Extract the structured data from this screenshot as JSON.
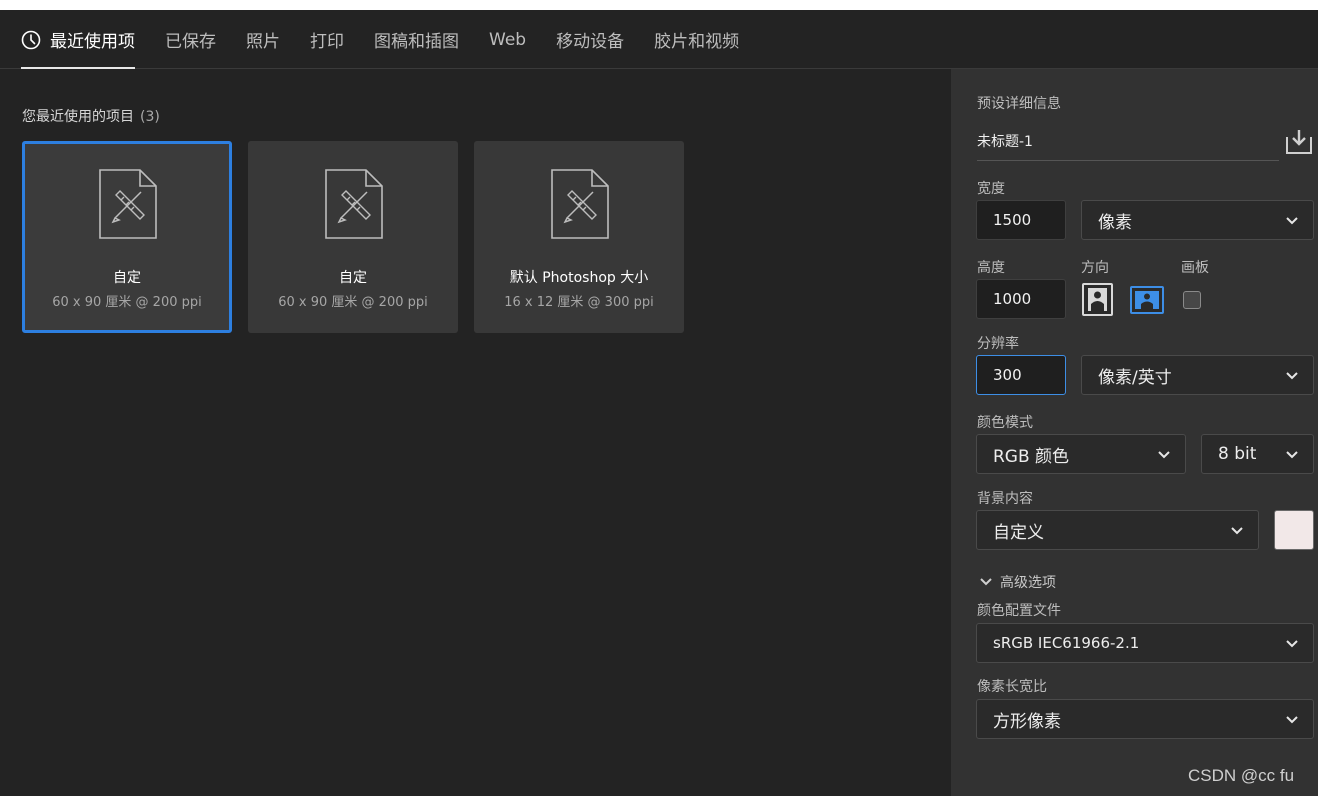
{
  "tabs": [
    {
      "label": "最近使用项",
      "active": true
    },
    {
      "label": "已保存"
    },
    {
      "label": "照片"
    },
    {
      "label": "打印"
    },
    {
      "label": "图稿和插图"
    },
    {
      "label": "Web"
    },
    {
      "label": "移动设备"
    },
    {
      "label": "胶片和视频"
    }
  ],
  "recent": {
    "title": "您最近使用的项目",
    "count": "(3)",
    "items": [
      {
        "name": "自定",
        "meta": "60 x 90 厘米 @ 200 ppi",
        "selected": true
      },
      {
        "name": "自定",
        "meta": "60 x 90 厘米 @ 200 ppi"
      },
      {
        "name": "默认 Photoshop 大小",
        "meta": "16 x 12 厘米 @ 300 ppi"
      }
    ]
  },
  "preset": {
    "header": "预设详细信息",
    "doc_title": "未标题-1",
    "width_label": "宽度",
    "width_value": "1500",
    "width_unit": "像素",
    "height_label": "高度",
    "height_value": "1000",
    "orientation_label": "方向",
    "artboard_label": "画板",
    "resolution_label": "分辨率",
    "resolution_value": "300",
    "resolution_unit": "像素/英寸",
    "color_mode_label": "颜色模式",
    "color_mode": "RGB 颜色",
    "bit_depth": "8 bit",
    "background_label": "背景内容",
    "background": "自定义",
    "background_color": "#f2e8e8",
    "advanced_label": "高级选项",
    "profile_label": "颜色配置文件",
    "profile": "sRGB IEC61966-2.1",
    "pixel_aspect_label": "像素长宽比",
    "pixel_aspect": "方形像素"
  },
  "watermark": "CSDN @cc fu",
  "colors": {
    "accent": "#2d7fe0",
    "background": "#232323",
    "panel": "#323232"
  }
}
